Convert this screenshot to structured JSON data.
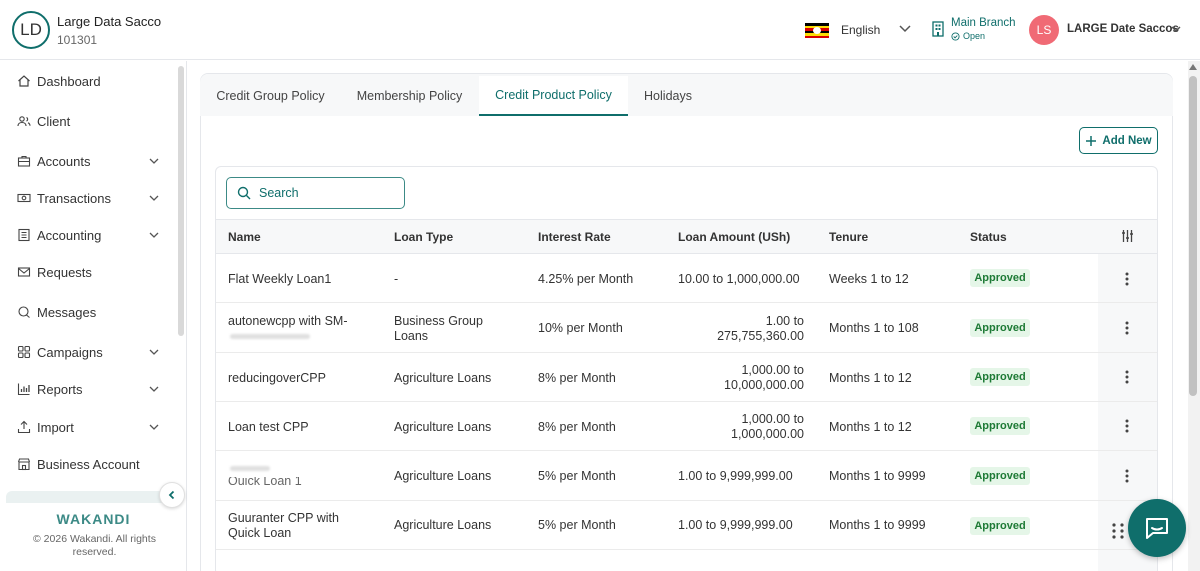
{
  "header": {
    "org_initials": "LD",
    "org_name": "Large Data Sacco",
    "org_code": "101301",
    "language": "English",
    "branch_name": "Main Branch",
    "branch_status": "Open",
    "user_initials": "LS",
    "user_name": "LARGE Date Saccos"
  },
  "sidebar": {
    "items": [
      {
        "label": "Dashboard",
        "icon": "home-icon"
      },
      {
        "label": "Client",
        "icon": "users-icon"
      },
      {
        "label": "Accounts",
        "icon": "briefcase-icon",
        "expandable": true
      },
      {
        "label": "Transactions",
        "icon": "money-icon",
        "expandable": true
      },
      {
        "label": "Accounting",
        "icon": "ledger-icon",
        "expandable": true
      },
      {
        "label": "Requests",
        "icon": "mail-icon"
      },
      {
        "label": "Messages",
        "icon": "chat-icon"
      },
      {
        "label": "Campaigns",
        "icon": "grid-icon",
        "expandable": true
      },
      {
        "label": "Reports",
        "icon": "bar-chart-icon",
        "expandable": true
      },
      {
        "label": "Import",
        "icon": "upload-icon",
        "expandable": true
      },
      {
        "label": "Business Account",
        "icon": "store-icon"
      }
    ],
    "brand": "WAKANDI",
    "copyright": "© 2026 Wakandi. All rights reserved."
  },
  "tabs": [
    {
      "label": "Credit Group Policy",
      "active": false
    },
    {
      "label": "Membership Policy",
      "active": false
    },
    {
      "label": "Credit Product Policy",
      "active": true
    },
    {
      "label": "Holidays",
      "active": false
    }
  ],
  "toolbar": {
    "add_label": "Add New",
    "search_placeholder": "Search"
  },
  "table": {
    "columns": [
      "Name",
      "Loan Type",
      "Interest Rate",
      "Loan Amount (USh)",
      "Tenure",
      "Status"
    ],
    "rows": [
      {
        "name": [
          "Flat Weekly Loan1"
        ],
        "loan_type": [
          "-"
        ],
        "interest": "4.25% per Month",
        "amount": [
          "10.00 to 1,000,000.00"
        ],
        "tenure": "Weeks 1 to 12",
        "status": "Approved"
      },
      {
        "name": [
          "autonewcpp with SM-"
        ],
        "loan_type": [
          "Business Group",
          "Loans"
        ],
        "interest": "10% per Month",
        "amount": [
          "1.00 to",
          "275,755,360.00"
        ],
        "tenure": "Months 1 to 108",
        "status": "Approved"
      },
      {
        "name": [
          "reducingoverCPP"
        ],
        "loan_type": [
          "Agriculture Loans"
        ],
        "interest": "8% per Month",
        "amount": [
          "1,000.00 to",
          "10,000,000.00"
        ],
        "tenure": "Months 1 to 12",
        "status": "Approved"
      },
      {
        "name": [
          "Loan test CPP"
        ],
        "loan_type": [
          "Agriculture Loans"
        ],
        "interest": "8% per Month",
        "amount": [
          "1,000.00 to",
          "1,000,000.00"
        ],
        "tenure": "Months 1 to 12",
        "status": "Approved"
      },
      {
        "name": [
          "Quick Loan 1"
        ],
        "loan_type": [
          "Agriculture Loans"
        ],
        "interest": "5% per Month",
        "amount": [
          "1.00 to 9,999,999.00"
        ],
        "tenure": "Months 1 to 9999",
        "status": "Approved"
      },
      {
        "name": [
          "Guuranter CPP with",
          "Quick Loan"
        ],
        "loan_type": [
          "Agriculture Loans"
        ],
        "interest": "5% per Month",
        "amount": [
          "1.00 to 9,999,999.00"
        ],
        "tenure": "Months 1 to 9999",
        "status": "Approved"
      }
    ]
  },
  "colors": {
    "accent": "#0f6e6b",
    "approved_bg": "#e5f6e8",
    "approved_text": "#1d7a35",
    "avatar_pink": "#f06a75"
  }
}
